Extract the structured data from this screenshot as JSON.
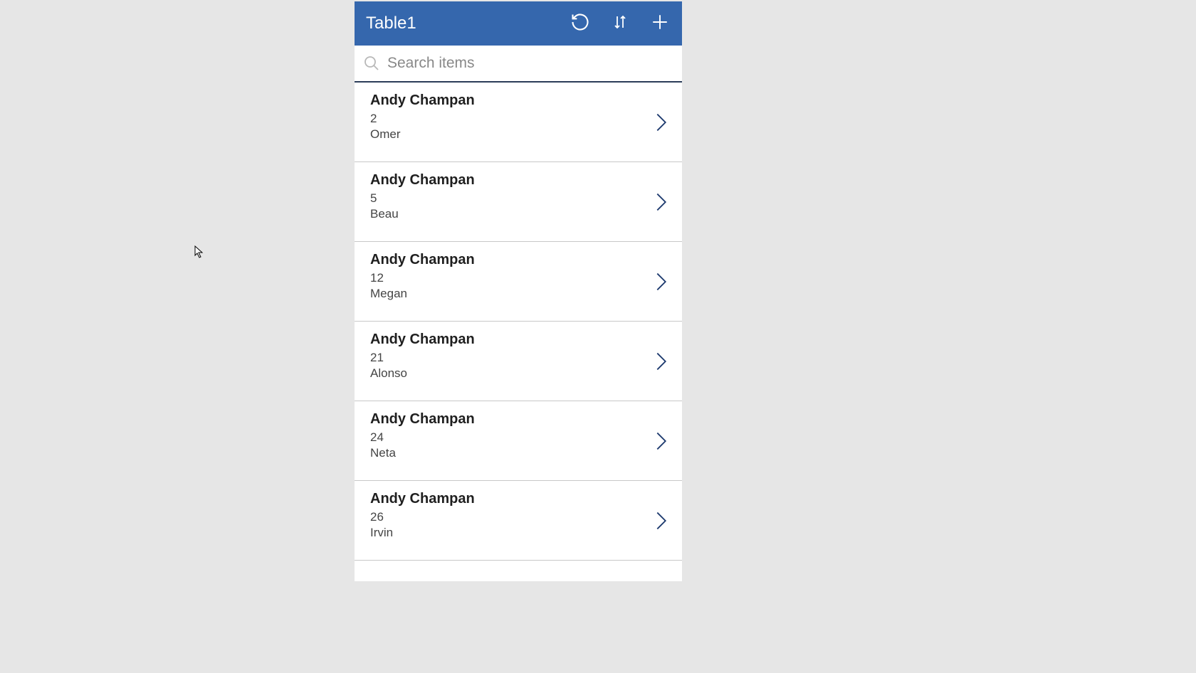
{
  "header": {
    "title": "Table1"
  },
  "search": {
    "placeholder": "Search items",
    "value": ""
  },
  "items": [
    {
      "title": "Andy Champan",
      "number": "2",
      "subtitle": "Omer"
    },
    {
      "title": "Andy Champan",
      "number": "5",
      "subtitle": "Beau"
    },
    {
      "title": "Andy Champan",
      "number": "12",
      "subtitle": "Megan"
    },
    {
      "title": "Andy Champan",
      "number": "21",
      "subtitle": "Alonso"
    },
    {
      "title": "Andy Champan",
      "number": "24",
      "subtitle": "Neta"
    },
    {
      "title": "Andy Champan",
      "number": "26",
      "subtitle": "Irvin"
    }
  ]
}
